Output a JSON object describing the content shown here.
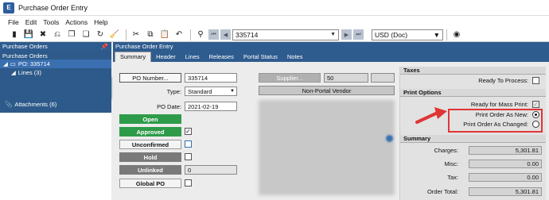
{
  "window": {
    "title": "Purchase Order Entry"
  },
  "menu": [
    "File",
    "Edit",
    "Tools",
    "Actions",
    "Help"
  ],
  "toolbar": {
    "po_number": "335714",
    "currency": "USD (Doc)"
  },
  "left_panel": {
    "title": "Purchase Orders",
    "root": "Purchase Orders",
    "selected": "PO: 335714",
    "lines": "Lines (3)",
    "attachments": "Attachments (6)"
  },
  "main": {
    "title": "Purchase Order Entry",
    "tabs": [
      "Summary",
      "Header",
      "Lines",
      "Releases",
      "Portal Status",
      "Notes"
    ],
    "po_number_btn": "PO Number...",
    "po_number_value": "335714",
    "type_label": "Type:",
    "type_value": "Standard",
    "po_date_label": "PO Date:",
    "po_date_value": "2021-02-19",
    "statuses": [
      {
        "label": "Open",
        "bg": "#2e9b4a",
        "color": "#ffffff"
      },
      {
        "label": "Approved",
        "bg": "#2e9b4a",
        "color": "#ffffff"
      },
      {
        "label": "Unconfirmed",
        "bg": "#f4f4f4",
        "color": "#111111"
      },
      {
        "label": "Hold",
        "bg": "#7a7a7a",
        "color": "#ffffff"
      },
      {
        "label": "Unlinked",
        "bg": "#7a7a7a",
        "color": "#ffffff"
      },
      {
        "label": "Global PO",
        "bg": "#f4f4f4",
        "color": "#111111"
      }
    ],
    "approved_check": "✓",
    "unlinked_value": "0",
    "supplier_btn": "Supplier...",
    "supplier_id": "50",
    "vendor_type": "Non-Portal Vendor"
  },
  "taxes": {
    "title": "Taxes",
    "ready_to_process": "Ready To Process:"
  },
  "print_options": {
    "title": "Print Options",
    "ready_mass_print": "Ready for Mass Print:",
    "print_new": "Print Order As New:",
    "print_changed": "Print Order As Changed:"
  },
  "summary": {
    "title": "Summary",
    "charges_label": "Charges:",
    "charges": "5,301.81",
    "misc_label": "Misc:",
    "misc": "0.00",
    "tax_label": "Tax:",
    "tax": "0.00",
    "total_label": "Order Total:",
    "total": "5,301.81"
  },
  "colors": {
    "header": "#2f5c8f",
    "highlight": "#e03535"
  }
}
